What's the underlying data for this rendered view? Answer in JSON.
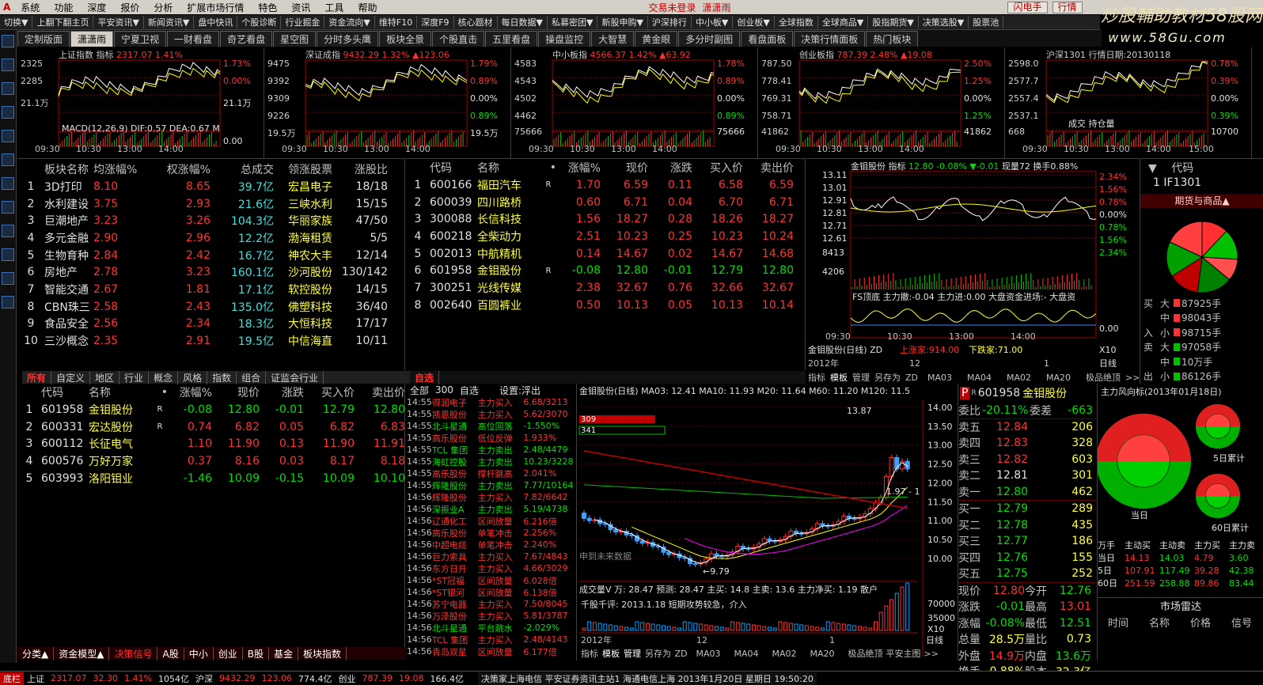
{
  "menu": [
    "系统",
    "功能",
    "深度",
    "报价",
    "分析",
    "扩展市场行情",
    "特色",
    "资讯",
    "工具",
    "帮助"
  ],
  "login": {
    "status": "交易未登录",
    "user": "潇潇雨",
    "flash": "闪电手",
    "quote": "行情"
  },
  "logo": {
    "l1": "炒股輔助教材58股网",
    "l2": "www.58Gu.com"
  },
  "toolbar1": [
    "切换▼",
    "上翻下翻主页",
    "平安资讯▼",
    "新闻资讯▼",
    "盘中快讯",
    "个股诊断",
    "行业掘金",
    "资金流向▼",
    "维特F10",
    "深度F9",
    "核心题材",
    "每日数据▼",
    "私募密团▼",
    "新股申购▼",
    "沪深排行",
    "中小板▼",
    "创业板▼",
    "全球指数",
    "全球商品▼",
    "股指期货▼",
    "决策选股▼",
    "股票池"
  ],
  "tabs": [
    "定制版面",
    "潇潇雨",
    "宁夏卫视",
    "一财看盘",
    "奇艺看盘",
    "星空图",
    "分时多头鹰",
    "板块全景",
    "个股直击",
    "五里看盘",
    "操盘监控",
    "大智慧",
    "黄金眼",
    "多分时副图",
    "看盘面板",
    "决策行情面板",
    "热门板块"
  ],
  "active_tab": "潇潇雨",
  "minis": [
    {
      "title": "上证指数",
      "sub": "指标",
      "val": "2317.07",
      "pct": "1.41%",
      "l": [
        "2325",
        "2285",
        "21.1万"
      ],
      "r": [
        "1.73%",
        "0.00%",
        "21.1万"
      ],
      "extra": "MACD(12,26,9) DIF:0.57 DEA:0.67 M",
      "bottom": "0.00"
    },
    {
      "title": "深证成指",
      "val": "9432.29",
      "pct": "1.32%",
      "chg": "▲123.06",
      "l": [
        "9475",
        "9392",
        "9309",
        "9226",
        "19.5万"
      ],
      "r": [
        "1.79%",
        "0.89%",
        "0.00%",
        "0.89%",
        "19.5万"
      ]
    },
    {
      "title": "中小板指",
      "val": "4566.37",
      "pct": "1.42%",
      "chg": "▲63.92",
      "l": [
        "4583",
        "4543",
        "4502",
        "4462",
        "75666"
      ],
      "r": [
        "1.78%",
        "0.89%",
        "0.00%",
        "0.89%",
        "75666"
      ]
    },
    {
      "title": "创业板指",
      "val": "787.39",
      "pct": "2.48%",
      "chg": "▲19.08",
      "l": [
        "787.50",
        "778.41",
        "769.31",
        "758.71",
        "41862"
      ],
      "r": [
        "2.50%",
        "1.25%",
        "0.00%",
        "1.25%",
        "41862"
      ]
    },
    {
      "title": "沪深1301",
      "sub": "行情日期:20130118",
      "l": [
        "2598.0",
        "2577.7",
        "2557.4",
        "2537.1",
        "668"
      ],
      "r": [
        "0.78%",
        "0.39%",
        "0.00%",
        "0.39%",
        "10700"
      ],
      "extra": "成交 持仓量"
    }
  ],
  "mini_times": [
    "09:30",
    "10:30",
    "13:00",
    "14:00"
  ],
  "mini_times_last": "15:00",
  "sectors": {
    "headers": [
      "",
      "板块名称",
      "均涨幅%",
      "权涨幅%",
      "总成交",
      "领涨股票",
      "涨股比"
    ],
    "rows": [
      [
        "1",
        "3D打印",
        "8.10",
        "8.65",
        "39.7亿",
        "宏昌电子",
        "18/18"
      ],
      [
        "2",
        "水利建设",
        "3.75",
        "2.93",
        "21.6亿",
        "三峡水利",
        "15/15"
      ],
      [
        "3",
        "巨潮地产",
        "3.23",
        "3.26",
        "104.3亿",
        "华丽家族",
        "47/50"
      ],
      [
        "4",
        "多元金融",
        "2.90",
        "2.96",
        "12.2亿",
        "渤海租赁",
        "5/5"
      ],
      [
        "5",
        "生物育种",
        "2.84",
        "2.42",
        "16.7亿",
        "神农大丰",
        "12/14"
      ],
      [
        "6",
        "房地产",
        "2.78",
        "3.23",
        "160.1亿",
        "沙河股份",
        "130/142"
      ],
      [
        "7",
        "智能交通",
        "2.67",
        "1.81",
        "17.1亿",
        "软控股份",
        "14/15"
      ],
      [
        "8",
        "CBN珠三",
        "2.58",
        "2.43",
        "135.0亿",
        "佛塑科技",
        "36/40"
      ],
      [
        "9",
        "食品安全",
        "2.56",
        "2.34",
        "18.3亿",
        "大恒科技",
        "17/17"
      ],
      [
        "10",
        "三沙概念",
        "2.35",
        "2.91",
        "19.5亿",
        "中信海直",
        "10/11"
      ]
    ]
  },
  "watch": {
    "headers": [
      "",
      "代码",
      "名称",
      "•",
      "涨幅%",
      "现价",
      "涨跌",
      "买入价",
      "卖出价"
    ],
    "rows": [
      [
        "1",
        "600166",
        "福田汽车",
        "R",
        "1.70",
        "6.59",
        "0.11",
        "6.58",
        "6.59"
      ],
      [
        "2",
        "600039",
        "四川路桥",
        "",
        "0.60",
        "6.71",
        "0.04",
        "6.70",
        "6.71"
      ],
      [
        "3",
        "300088",
        "长信科技",
        "",
        "1.56",
        "18.27",
        "0.28",
        "18.26",
        "18.27"
      ],
      [
        "4",
        "600218",
        "全柴动力",
        "",
        "2.51",
        "10.23",
        "0.25",
        "10.23",
        "10.24"
      ],
      [
        "5",
        "002013",
        "中航精机",
        "",
        "0.14",
        "14.67",
        "0.02",
        "14.67",
        "14.68"
      ],
      [
        "6",
        "601958",
        "金钼股份",
        "R",
        "-0.08",
        "12.80",
        "-0.01",
        "12.79",
        "12.80"
      ],
      [
        "7",
        "300251",
        "光线传媒",
        "",
        "2.38",
        "32.67",
        "0.76",
        "32.66",
        "32.67"
      ],
      [
        "8",
        "002640",
        "百圆裤业",
        "",
        "0.50",
        "10.13",
        "0.05",
        "10.13",
        "10.14"
      ]
    ]
  },
  "intraday": {
    "name": "金钼股份",
    "sub": "指标",
    "val": "12.80",
    "pct": "-0.08%",
    "chg": "▼-0.01",
    "vol": "现量72",
    "turn": "换手0.88%",
    "l": [
      "13.11",
      "13.01",
      "12.91",
      "12.81",
      "12.71",
      "12.61",
      "8413",
      "4206"
    ],
    "r": [
      "2.34%",
      "1.56%",
      "0.78%",
      "0.00%",
      "0.78%",
      "1.56%",
      "2.34%"
    ],
    "ind": "FS顶底 主力撤:-0.04 主力进:0.00 大盘资金进场:- 大盘资",
    "zero": "0.00",
    "times": [
      "09:30",
      "10:30",
      "13:00",
      "14:00"
    ],
    "title2": "金钼股份(日线) ZD",
    "up": "上涨家:914.00",
    "down": "下跌家:71.00",
    "x10": "X10",
    "yr": "2012年",
    "m12": "12",
    "m1": "1",
    "rixian": "日线",
    "tabs2": [
      "指标",
      "模板",
      "管理",
      "另存为",
      "ZD",
      "MA03",
      "MA04",
      "MA02",
      "MA20",
      "极品绝顶",
      ">>"
    ]
  },
  "futures": {
    "code_hdr": "代码",
    "code": "1 IF1301",
    "title": "期货与商品▲",
    "big": [
      [
        "买",
        "大",
        "87925手"
      ],
      [
        "",
        "中",
        "98043手"
      ],
      [
        "入",
        "小",
        "98715手"
      ],
      [
        "卖",
        "大",
        "97058手"
      ],
      [
        "",
        "中",
        "10万手"
      ],
      [
        "出",
        "小",
        "86126手"
      ]
    ]
  },
  "tabs_bottom_left": [
    "所有",
    "自定义",
    "地区",
    "行业",
    "概念",
    "风格",
    "指数",
    "组合",
    "证监会行业"
  ],
  "mylist": {
    "headers": [
      "",
      "代码",
      "名称",
      "•",
      "涨幅%",
      "现价",
      "涨跌",
      "买入价",
      "卖出价"
    ],
    "rows": [
      [
        "1",
        "601958",
        "金钼股份",
        "R",
        "-0.08",
        "12.80",
        "-0.01",
        "12.79",
        "12.80"
      ],
      [
        "2",
        "600331",
        "宏达股份",
        "R",
        "0.74",
        "6.82",
        "0.05",
        "6.82",
        "6.83"
      ],
      [
        "3",
        "600112",
        "长征电气",
        "",
        "1.10",
        "11.90",
        "0.13",
        "11.90",
        "11.91"
      ],
      [
        "4",
        "600576",
        "万好万家",
        "",
        "0.37",
        "8.16",
        "0.03",
        "8.17",
        "8.18"
      ],
      [
        "5",
        "603993",
        "洛阳钼业",
        "",
        "-1.46",
        "10.09",
        "-0.15",
        "10.09",
        "10.10"
      ]
    ]
  },
  "bottom_tabs": [
    "分类▲",
    "资金模型▲",
    "决策信号",
    "A股",
    "中小",
    "创业",
    "B股",
    "基金",
    "板块指数"
  ],
  "zixuan": "自选",
  "signals": {
    "hdr": [
      "全部",
      "300",
      "自选",
      "设置:浮出"
    ],
    "rows": [
      [
        "14:55",
        "得润电子",
        "主力买入",
        "6.68/3213"
      ],
      [
        "14:55",
        "凯恩股份",
        "主力买入",
        "5.62/3070"
      ],
      [
        "14:55",
        "北斗星通",
        "高位回落",
        "-1.550%"
      ],
      [
        "14:55",
        "高乐股份",
        "低位反弹",
        "1.933%"
      ],
      [
        "14:55",
        "TCL 集团",
        "主力卖出",
        "2.48/4479"
      ],
      [
        "14:55",
        "海虹控股",
        "主力卖出",
        "10.23/3228"
      ],
      [
        "14:55",
        "高乐股份",
        "撑杆跳高",
        "2.041%"
      ],
      [
        "14:55",
        "辉隆股份",
        "主力卖出",
        "7.77/10164"
      ],
      [
        "14:56",
        "辉隆股份",
        "主力买入",
        "7.82/6642"
      ],
      [
        "14:56",
        "深振业A",
        "主力卖出",
        "5.19/4738"
      ],
      [
        "14:56",
        "辽通化工",
        "区间放量",
        "6.216倍"
      ],
      [
        "14:56",
        "高乐股份",
        "单笔冲击",
        "2.256%"
      ],
      [
        "14:56",
        "中超电缆",
        "单笔冲击",
        "2.240%"
      ],
      [
        "14:56",
        "巨力索具",
        "主力买入",
        "7.67/4843"
      ],
      [
        "14:56",
        "东方日升",
        "主力买入",
        "4.66/3029"
      ],
      [
        "14:56",
        "*ST冠福",
        "区间放量",
        "6.028倍"
      ],
      [
        "14:56",
        "*ST银河",
        "区间放量",
        "6.138倍"
      ],
      [
        "14:56",
        "苏宁电器",
        "主力买入",
        "7.50/8045"
      ],
      [
        "14:56",
        "万泽股份",
        "主力买入",
        "5.81/3787"
      ],
      [
        "14:56",
        "北斗星通",
        "平台跳水",
        "-2.029%"
      ],
      [
        "14:56",
        "TCL 集团",
        "主力买入",
        "2.48/4143"
      ],
      [
        "14:56",
        "青岛双星",
        "区间放量",
        "6.177倍"
      ]
    ]
  },
  "kline": {
    "title": "金钼股份(日线) MA03: 12.41 MA10: 11.93 M20: 11.64 M60: 11.20 M120: 11.5",
    "box1": "309",
    "box2": "341",
    "high": "13.87",
    "low": "9.79",
    "mark": "1.97 - 1",
    "future": "申到未来数据",
    "y": [
      "14.00",
      "13.50",
      "13.00",
      "12.50",
      "12.00",
      "11.50",
      "11.00",
      "10.50",
      "10.00"
    ],
    "vol_title": "成交量V 万: 28.47 预测: 28.47 主买: 14.8 主卖: 13.6 主力净买: 1.19 散户",
    "news": "千股千评: 2013.1.18 短期攻势较急，介入",
    "vy": [
      "70000",
      "35000"
    ],
    "x10": "X10",
    "yr": "2012年",
    "m12": "12",
    "m1": "1",
    "rixian": "日线",
    "tabs": [
      "指标",
      "模板",
      "管理",
      "另存为",
      "ZD",
      "MA03",
      "MA04",
      "MA02",
      "MA20",
      "极品绝顶",
      "平安主图",
      ">>"
    ]
  },
  "orderbook": {
    "p": "P",
    "code": "601958",
    "name": "金钼股份",
    "r": "R",
    "sub": "300",
    "wb": "委比",
    "wbv": "-20.11%",
    "wc": "委差",
    "wcv": "-663",
    "sell": [
      [
        "卖五",
        "12.84",
        "206"
      ],
      [
        "卖四",
        "12.83",
        "328"
      ],
      [
        "卖三",
        "12.82",
        "603"
      ],
      [
        "卖二",
        "12.81",
        "301"
      ],
      [
        "卖一",
        "12.80",
        "462"
      ]
    ],
    "buy": [
      [
        "买一",
        "12.79",
        "289"
      ],
      [
        "买二",
        "12.78",
        "435"
      ],
      [
        "买三",
        "12.77",
        "186"
      ],
      [
        "买四",
        "12.76",
        "155"
      ],
      [
        "买五",
        "12.75",
        "252"
      ]
    ],
    "stats": [
      [
        "现价",
        "12.80",
        "今开",
        "12.76"
      ],
      [
        "涨跌",
        "-0.01",
        "最高",
        "13.01"
      ],
      [
        "涨幅",
        "-0.08%",
        "最低",
        "12.51"
      ],
      [
        "总量",
        "28.5万",
        "量比",
        "0.73"
      ],
      [
        "外盘",
        "14.9万",
        "内盘",
        "13.6万"
      ],
      [
        "换手",
        "0.88%",
        "股本",
        "32.3亿"
      ]
    ]
  },
  "flow": {
    "title": "主力风向标(2013年01月18日)",
    "today": "当日",
    "d5": "5日累计",
    "d60": "60日累计",
    "hdr": [
      "万手",
      "主动买",
      "主动卖",
      "主力买",
      "主力卖"
    ],
    "rows": [
      [
        "当日",
        "14.13",
        "14.03",
        "4.79",
        "3.60"
      ],
      [
        "5日",
        "107.91",
        "117.49",
        "39.28",
        "42.38"
      ],
      [
        "60日",
        "251.59",
        "258.88",
        "89.86",
        "83.44"
      ]
    ],
    "radar": "市场雷达",
    "rhdr": [
      "时间",
      "名称",
      "价格",
      "信号"
    ]
  },
  "status": {
    "a": "底栏",
    "b": "上证",
    "c": "2317.07",
    "d": "32.30",
    "e": "1.41%",
    "f": "1054亿",
    "g": "沪深",
    "h": "9432.29",
    "i": "123.06",
    "j": "774.4亿",
    "k": "创业",
    "l": "787.39",
    "m": "19.08",
    "n": "166.4亿",
    "msg": "决策家上海电信 平安证券资讯主站1 海通电信上海 2013年1月20日 星期日 19:50:20"
  },
  "colors": {
    "up": "#ff3333",
    "down": "#00e000",
    "bg": "#000000",
    "grid": "#800000"
  }
}
